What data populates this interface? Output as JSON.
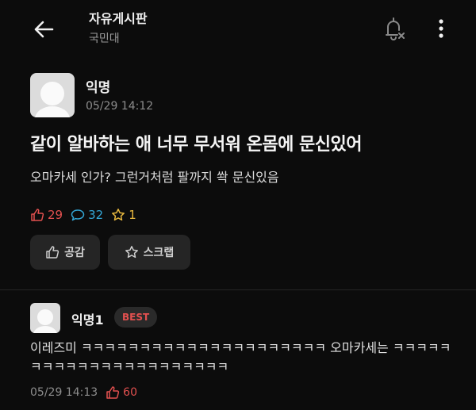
{
  "header": {
    "title": "자유게시판",
    "subtitle": "국민대",
    "back_icon": "back-arrow-icon",
    "bell_icon": "bell-off-icon",
    "more_icon": "more-vertical-icon"
  },
  "post": {
    "author": "익명",
    "time": "05/29 14:12",
    "title": "같이 알바하는 애 너무 무서워 온몸에 문신있어",
    "body": "오마카세 인가? 그런거처럼 팔까지 쏵 문신있음",
    "likes": "29",
    "comments": "32",
    "scraps": "1"
  },
  "actions": {
    "like_label": "공감",
    "scrap_label": "스크랩"
  },
  "comment": {
    "author": "익명1",
    "badge": "BEST",
    "text": "이레즈미 ㅋㅋㅋㅋㅋㅋㅋㅋㅋㅋㅋㅋㅋㅋㅋㅋㅋㅋㅋㅋㅋ 오마카세는 ㅋㅋㅋㅋㅋㅋㅋㅋㅋㅋㅋㅋㅋㅋㅋㅋㅋㅋㅋㅋㅋㅋ",
    "time": "05/29 14:13",
    "likes": "60"
  },
  "colors": {
    "background": "#0c0c0c",
    "like": "#e2504f",
    "comment": "#34a7d6",
    "scrap": "#e8b83e"
  }
}
